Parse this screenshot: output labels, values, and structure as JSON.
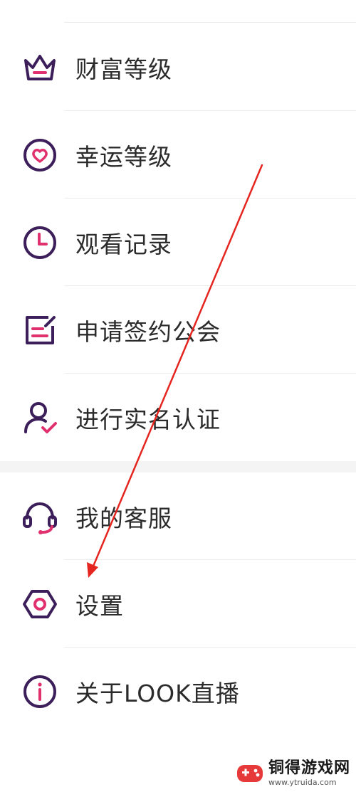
{
  "menu": {
    "items": [
      {
        "label": "财富等级",
        "icon": "crown-icon"
      },
      {
        "label": "幸运等级",
        "icon": "heart-circle-icon"
      },
      {
        "label": "观看记录",
        "icon": "clock-icon"
      },
      {
        "label": "申请签约公会",
        "icon": "edit-note-icon"
      },
      {
        "label": "进行实名认证",
        "icon": "user-check-icon"
      },
      {
        "label": "我的客服",
        "icon": "headset-icon"
      },
      {
        "label": "设置",
        "icon": "hexagon-settings-icon"
      },
      {
        "label": "关于LOOK直播",
        "icon": "info-icon"
      }
    ]
  },
  "colors": {
    "icon_primary": "#3c1f5a",
    "icon_accent": "#e0306e",
    "arrow": "#e5251f"
  },
  "watermark": {
    "title": "铜得游戏网",
    "url": "www.ytruida.com"
  }
}
